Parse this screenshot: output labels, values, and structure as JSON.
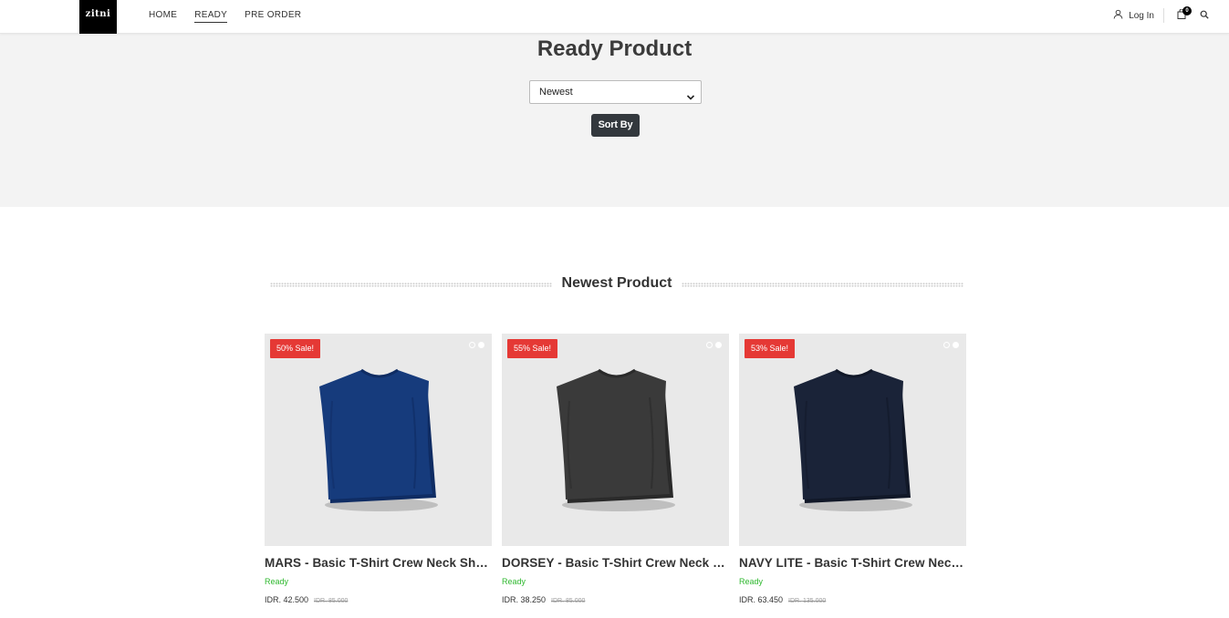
{
  "header": {
    "logo": "zitni",
    "nav": [
      {
        "label": "HOME",
        "active": false
      },
      {
        "label": "READY",
        "active": true
      },
      {
        "label": "PRE ORDER",
        "active": false
      }
    ],
    "login_label": "Log In",
    "cart_count": "0"
  },
  "hero": {
    "title": "Ready Product",
    "sort_value": "Newest",
    "sort_button": "Sort By"
  },
  "section": {
    "title": "Newest Product"
  },
  "products": [
    {
      "badge": "50% Sale!",
      "name": "MARS - Basic T-Shirt Crew Neck Short Sleeve",
      "status": "Ready",
      "price": "IDR. 42.500",
      "old_price": "IDR. 85.000",
      "shirt_color": "#163b7c",
      "shirt_shade": "#0f2c63"
    },
    {
      "badge": "55% Sale!",
      "name": "DORSEY - Basic T-Shirt Crew Neck Short Sleeve",
      "status": "Ready",
      "price": "IDR. 38.250",
      "old_price": "IDR. 85.000",
      "shirt_color": "#3a3a3a",
      "shirt_shade": "#2a2a2a"
    },
    {
      "badge": "53% Sale!",
      "name": "NAVY LITE - Basic T-Shirt Crew Neck Short Sleeve",
      "status": "Ready",
      "price": "IDR. 63.450",
      "old_price": "IDR. 135.000",
      "shirt_color": "#1a2338",
      "shirt_shade": "#111828"
    }
  ]
}
